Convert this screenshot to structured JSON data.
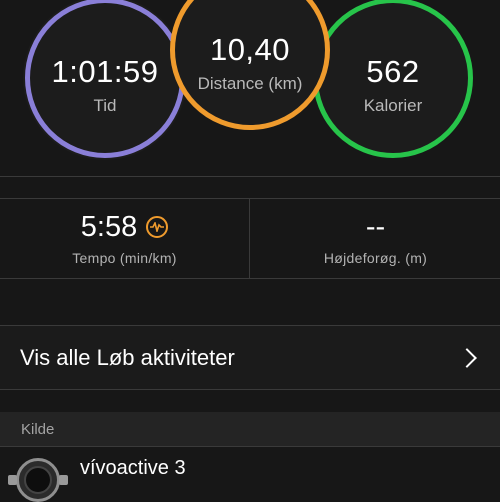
{
  "summary": {
    "time": {
      "value": "1:01:59",
      "label": "Tid"
    },
    "distance": {
      "value": "10,40",
      "label": "Distance (km)"
    },
    "calories": {
      "value": "562",
      "label": "Kalorier"
    }
  },
  "stats": {
    "pace": {
      "value": "5:58",
      "label": "Tempo (min/km)"
    },
    "elevation": {
      "value": "--",
      "label": "Højdeforøg. (m)"
    }
  },
  "link": {
    "label": "Vis alle Løb aktiviteter"
  },
  "source": {
    "header": "Kilde",
    "device": "vívoactive 3"
  },
  "colors": {
    "time_ring": "#8a7fd8",
    "distance_ring": "#ef9b2d",
    "calories_ring": "#27c44a",
    "background": "#171717"
  },
  "icons": {
    "pace": "heart-rate-pulse-icon",
    "chevron": "chevron-right-icon",
    "device": "watch-icon"
  }
}
